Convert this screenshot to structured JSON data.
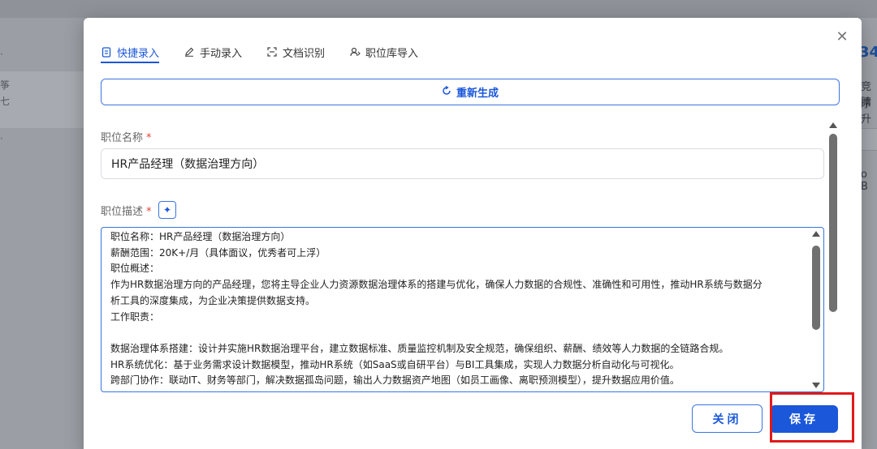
{
  "background": {
    "left_texts": [
      "·",
      "筝",
      "七",
      "·"
    ],
    "right_number": "34",
    "right_texts": [
      "竞腈",
      "序升",
      "o B"
    ]
  },
  "modal": {
    "close_icon": "close-icon",
    "tabs": [
      {
        "label": "快捷录入",
        "icon": "document-icon",
        "active": true
      },
      {
        "label": "手动录入",
        "icon": "pen-icon",
        "active": false
      },
      {
        "label": "文档识别",
        "icon": "scan-icon",
        "active": false
      },
      {
        "label": "职位库导入",
        "icon": "user-import-icon",
        "active": false
      }
    ],
    "regenerate_label": "重新生成",
    "title_field": {
      "label": "职位名称",
      "required_mark": "*",
      "value": "HR产品经理（数据治理方向）"
    },
    "description_field": {
      "label": "职位描述",
      "required_mark": "*",
      "ai_icon": "sparkle-icon",
      "lines": [
        "职位名称：HR产品经理（数据治理方向）",
        "薪酬范围：20K+/月（具体面议，优秀者可上浮）",
        "职位概述：",
        "作为HR数据治理方向的产品经理，您将主导企业人力资源数据治理体系的搭建与优化，确保人力数据的合规性、准确性和可用性，推动HR系统与数据分",
        "析工具的深度集成，为企业决策提供数据支持。",
        "工作职责：",
        "",
        "数据治理体系搭建：设计并实施HR数据治理平台，建立数据标准、质量监控机制及安全规范，确保组织、薪酬、绩效等人力数据的全链路合规。",
        "HR系统优化：基于业务需求设计数据模型，推动HR系统（如SaaS或自研平台）与BI工具集成，实现人力数据分析自动化与可视化。",
        "跨部门协作：联动IT、财务等部门，解决数据孤岛问题，输出人力数据资产地图（如员工画像、离职预测模型），提升数据应用价值。"
      ]
    },
    "footer": {
      "close_label": "关闭",
      "save_label": "保存"
    }
  },
  "colors": {
    "accent": "#1a57d9",
    "required": "#e0433a",
    "highlight": "#e11919"
  }
}
